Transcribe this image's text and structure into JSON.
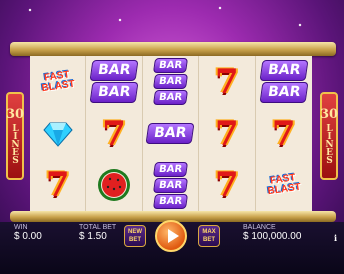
{
  "side_label": {
    "number": "30",
    "text": "LINES"
  },
  "reels": [
    [
      "fast-blast",
      "diamond",
      "seven"
    ],
    [
      "bar-2",
      "seven",
      "watermelon"
    ],
    [
      "bar-3",
      "bar-1",
      "bar-3"
    ],
    [
      "seven",
      "seven",
      "seven"
    ],
    [
      "bar-2",
      "seven",
      "fast-blast"
    ]
  ],
  "symbol_text": {
    "bar": "BAR",
    "fast": "FAST",
    "blast": "BLAST",
    "seven": "7"
  },
  "footer": {
    "win_label": "WIN",
    "win_value": "$ 0.00",
    "total_bet_label": "TOTAL BET",
    "total_bet_value": "$ 1.50",
    "new_bet_line1": "NEW",
    "new_bet_line2": "BET",
    "max_bet_line1": "MAX",
    "max_bet_line2": "BET",
    "balance_label": "BALANCE",
    "balance_value": "$ 100,000.00",
    "info": "i"
  },
  "colors": {
    "seven": "#e01818",
    "bar": "#8a3ce6",
    "rail": "#c9a24b",
    "side": "#c01818"
  }
}
